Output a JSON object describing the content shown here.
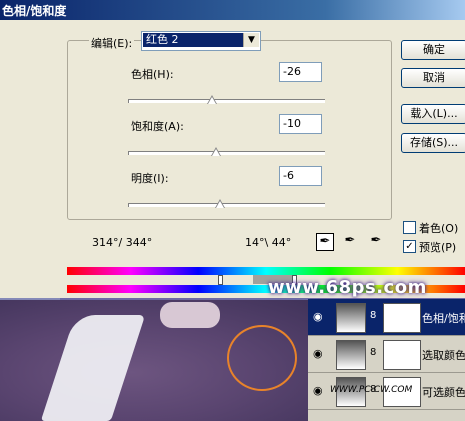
{
  "dialog": {
    "title": "色相/饱和度",
    "edit_label": "编辑(E):",
    "edit_value": "红色 2",
    "hue_label": "色相(H):",
    "hue_value": "-26",
    "hue_level": -26,
    "sat_label": "饱和度(A):",
    "sat_value": "-10",
    "sat_level": -10,
    "light_label": "明度(I):",
    "light_value": "-6",
    "light_level": -6,
    "range_left": "314°/ 344°",
    "range_right": "14°\\ 44°",
    "buttons": {
      "ok": "确定",
      "cancel": "取消",
      "load": "载入(L)...",
      "save": "存储(S)..."
    },
    "colorize_label": "着色(O)",
    "colorize_checked": false,
    "preview_label": "预览(P)",
    "preview_checked": true
  },
  "watermark": "www.68ps.com",
  "layers": [
    {
      "name": "色相/饱和",
      "active": true
    },
    {
      "name": "选取颜色",
      "active": false
    },
    {
      "name": "可选颜色",
      "active": false
    }
  ],
  "site_watermark": "WWW.PC-CW.COM"
}
